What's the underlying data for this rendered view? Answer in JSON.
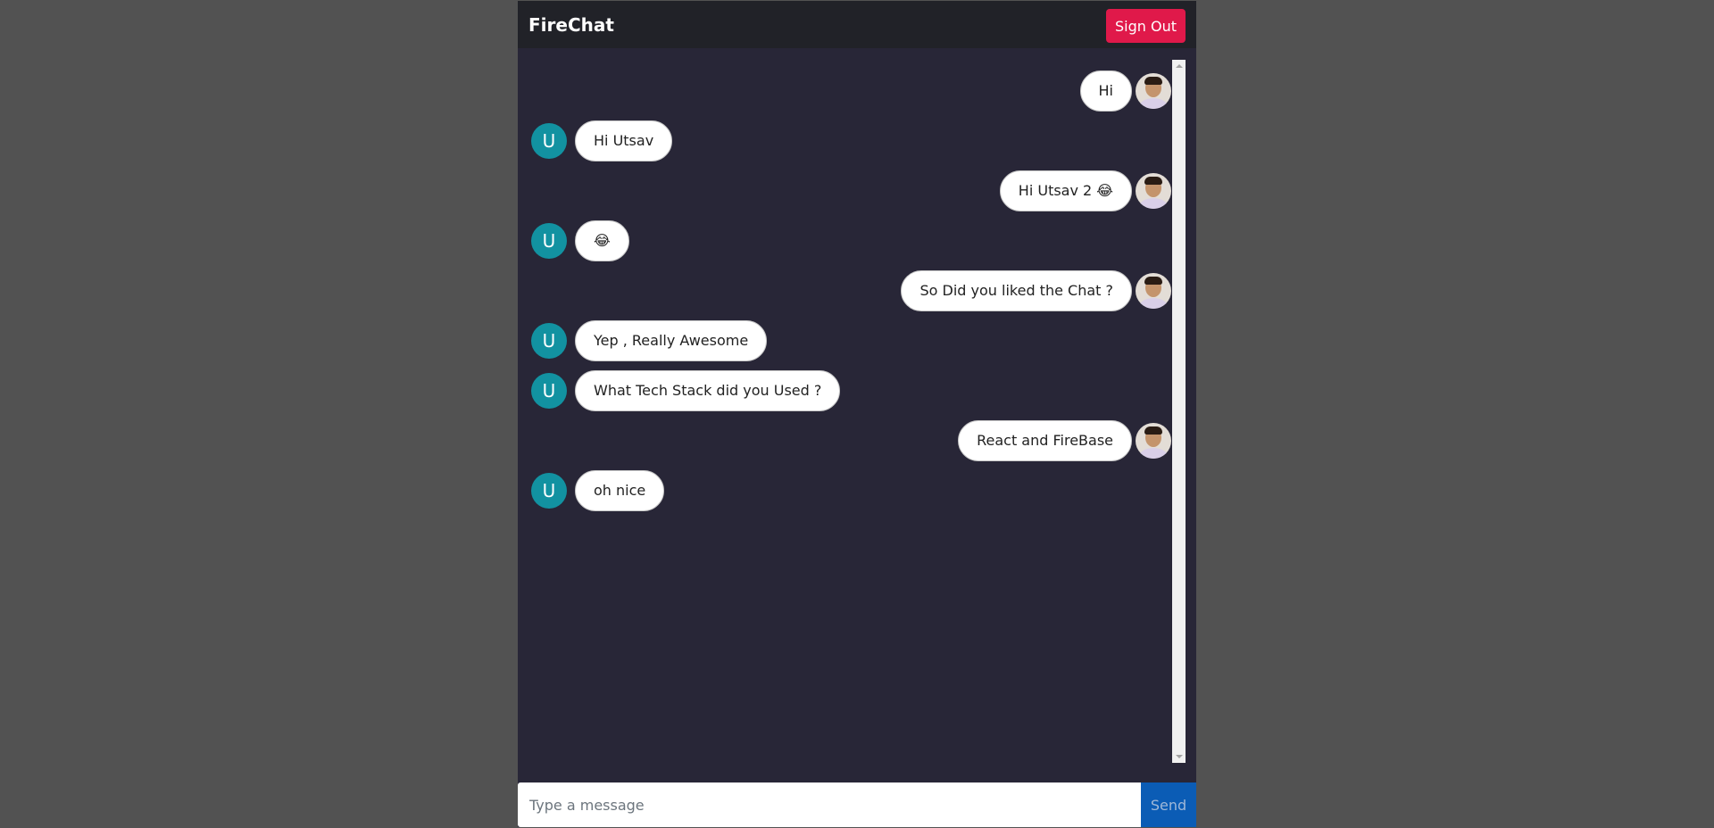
{
  "header": {
    "brand": "FireChat",
    "sign_out_label": "Sign Out"
  },
  "messages": [
    {
      "direction": "sent",
      "text": "Hi"
    },
    {
      "direction": "received",
      "avatar_letter": "U",
      "text": "Hi Utsav"
    },
    {
      "direction": "sent",
      "text": "Hi Utsav 2 😂"
    },
    {
      "direction": "received",
      "avatar_letter": "U",
      "text": "😂"
    },
    {
      "direction": "sent",
      "text": "So Did you liked the Chat ?"
    },
    {
      "direction": "received",
      "avatar_letter": "U",
      "text": "Yep , Really Awesome"
    },
    {
      "direction": "received",
      "avatar_letter": "U",
      "text": "What Tech Stack did you Used ?"
    },
    {
      "direction": "sent",
      "text": "React and FireBase"
    },
    {
      "direction": "received",
      "avatar_letter": "U",
      "text": "oh nice"
    }
  ],
  "composer": {
    "placeholder": "Type a message",
    "value": "",
    "send_label": "Send"
  },
  "colors": {
    "page_background": "#525252",
    "chat_background": "#282637",
    "header_background": "#212228",
    "sign_out_button": "#e0194a",
    "letter_avatar": "#1292a1",
    "send_button": "#0b5cb5"
  },
  "icons": {
    "sent_avatar": "user-photo-avatar",
    "received_avatar": "letter-avatar"
  }
}
